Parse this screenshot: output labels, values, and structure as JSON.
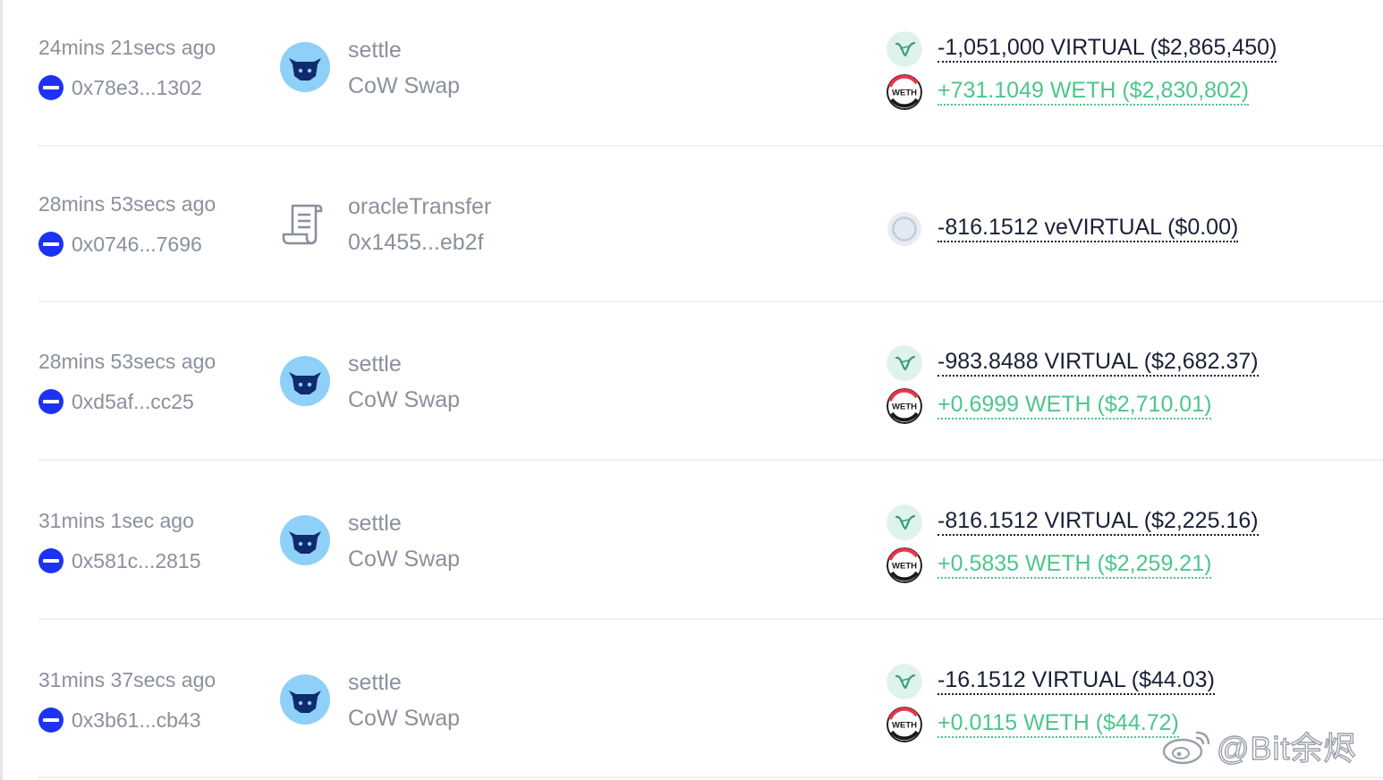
{
  "transactions": [
    {
      "time": "24mins 21secs ago",
      "address": "0x78e3...1302",
      "method": "settle",
      "protocol": "CoW Swap",
      "protocol_icon": "cow-icon",
      "transfers": [
        {
          "token": "VIRTUAL",
          "icon": "virtual-token-icon",
          "text": "-1,051,000 VIRTUAL ($2,865,450)",
          "direction": "out"
        },
        {
          "token": "WETH",
          "icon": "weth-token-icon",
          "text": "+731.1049 WETH ($2,830,802)",
          "direction": "in"
        }
      ]
    },
    {
      "time": "28mins 53secs ago",
      "address": "0x0746...7696",
      "method": "oracleTransfer",
      "protocol": "0x1455...eb2f",
      "protocol_icon": "contract-scroll-icon",
      "transfers": [
        {
          "token": "veVIRTUAL",
          "icon": "vevirtual-token-icon",
          "text": "-816.1512 veVIRTUAL ($0.00)",
          "direction": "out"
        }
      ]
    },
    {
      "time": "28mins 53secs ago",
      "address": "0xd5af...cc25",
      "method": "settle",
      "protocol": "CoW Swap",
      "protocol_icon": "cow-icon",
      "transfers": [
        {
          "token": "VIRTUAL",
          "icon": "virtual-token-icon",
          "text": "-983.8488 VIRTUAL ($2,682.37)",
          "direction": "out"
        },
        {
          "token": "WETH",
          "icon": "weth-token-icon",
          "text": "+0.6999 WETH ($2,710.01)",
          "direction": "in"
        }
      ]
    },
    {
      "time": "31mins 1sec ago",
      "address": "0x581c...2815",
      "method": "settle",
      "protocol": "CoW Swap",
      "protocol_icon": "cow-icon",
      "transfers": [
        {
          "token": "VIRTUAL",
          "icon": "virtual-token-icon",
          "text": "-816.1512 VIRTUAL ($2,225.16)",
          "direction": "out"
        },
        {
          "token": "WETH",
          "icon": "weth-token-icon",
          "text": "+0.5835 WETH ($2,259.21)",
          "direction": "in"
        }
      ]
    },
    {
      "time": "31mins 37secs ago",
      "address": "0x3b61...cb43",
      "method": "settle",
      "protocol": "CoW Swap",
      "protocol_icon": "cow-icon",
      "transfers": [
        {
          "token": "VIRTUAL",
          "icon": "virtual-token-icon",
          "text": "-16.1512 VIRTUAL ($44.03)",
          "direction": "out"
        },
        {
          "token": "WETH",
          "icon": "weth-token-icon",
          "text": "+0.0115 WETH ($44.72)",
          "direction": "in"
        }
      ]
    }
  ],
  "token_logo_text": {
    "weth": "WETH"
  },
  "watermark": {
    "text": "@Bit余烬"
  },
  "colors": {
    "address_dot": "#1c33f5",
    "cow_circle": "#8ed0f7",
    "cow_face": "#102a6e",
    "positive": "#4cc68a",
    "negative": "#1a1f36",
    "muted_text": "#8a909c"
  }
}
